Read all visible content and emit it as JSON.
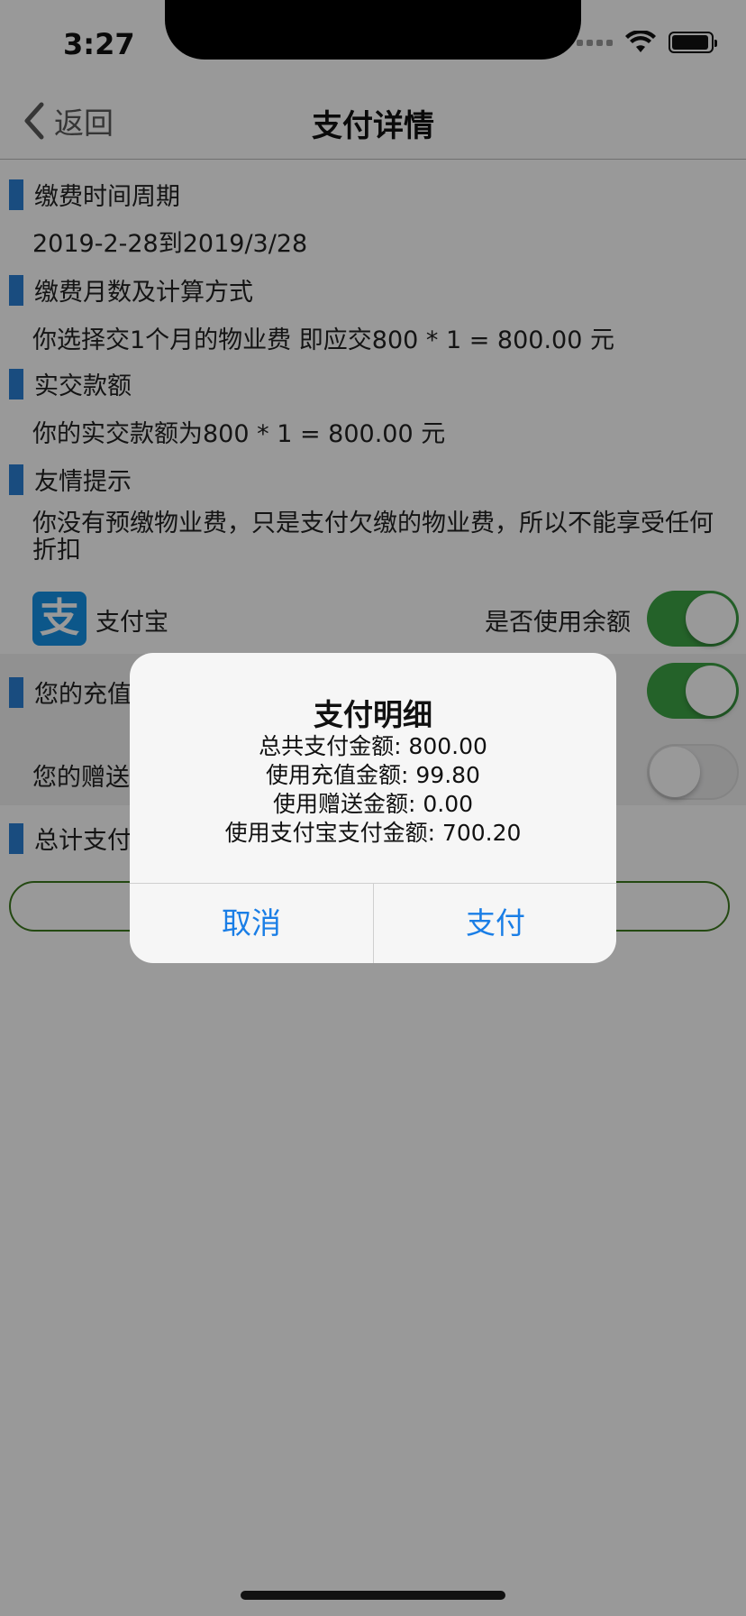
{
  "status_bar": {
    "time": "3:27"
  },
  "nav": {
    "back_label": "返回",
    "title": "支付详情"
  },
  "sections": {
    "period": {
      "title": "缴费时间周期",
      "value": "2019-2-28到2019/3/28"
    },
    "months": {
      "title": "缴费月数及计算方式",
      "value": "你选择交1个月的物业费 即应交800 * 1 = 800.00 元"
    },
    "paid": {
      "title": "实交款额",
      "value": "你的实交款额为800 * 1 = 800.00 元"
    },
    "tip": {
      "title": "友情提示",
      "value": "你没有预缴物业费，只是支付欠缴的物业费，所以不能享受任何折扣"
    }
  },
  "payment": {
    "alipay_label": "支付宝",
    "use_balance_label": "是否使用余额",
    "use_balance_on": true,
    "recharge_label": "您的充值",
    "recharge_on": true,
    "gift_label": "您的赠送",
    "gift_on": false,
    "total_label": "总计支付"
  },
  "alert": {
    "title": "支付明细",
    "lines": [
      "总共支付金额: 800.00",
      "使用充值金额: 99.80",
      "使用赠送金额: 0.00",
      "使用支付宝支付金额: 700.20"
    ],
    "cancel_label": "取消",
    "confirm_label": "支付"
  },
  "colors": {
    "accent_blue": "#1a7ee6",
    "section_bar": "#2a7fd4",
    "switch_on": "#3da345",
    "pay_button_border": "#3d7a1f"
  },
  "icons": {
    "back": "chevron-left-icon",
    "alipay": "alipay-logo-icon",
    "wifi": "wifi-icon",
    "battery": "battery-icon",
    "signal": "cellular-signal-icon"
  }
}
